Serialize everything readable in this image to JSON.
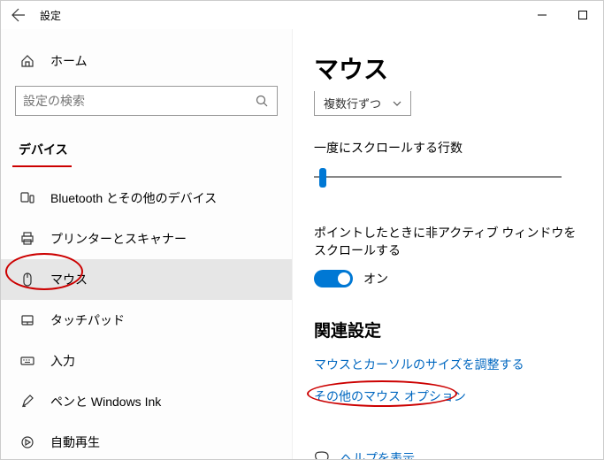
{
  "titlebar": {
    "title": "設定"
  },
  "sidebar": {
    "home_label": "ホーム",
    "search_placeholder": "設定の検索",
    "category": "デバイス",
    "items": [
      {
        "label": "Bluetooth とその他のデバイス"
      },
      {
        "label": "プリンターとスキャナー"
      },
      {
        "label": "マウス"
      },
      {
        "label": "タッチパッド"
      },
      {
        "label": "入力"
      },
      {
        "label": "ペンと Windows Ink"
      },
      {
        "label": "自動再生"
      }
    ]
  },
  "content": {
    "page_title": "マウス",
    "dropdown_partial": "複数行ずつ",
    "scroll_lines_label": "一度にスクロールする行数",
    "inactive_scroll_label": "ポイントしたときに非アクティブ ウィンドウをスクロールする",
    "toggle_state": "オン",
    "related_header": "関連設定",
    "link_size": "マウスとカーソルのサイズを調整する",
    "link_other": "その他のマウス オプション",
    "help_label": "ヘルプを表示"
  }
}
